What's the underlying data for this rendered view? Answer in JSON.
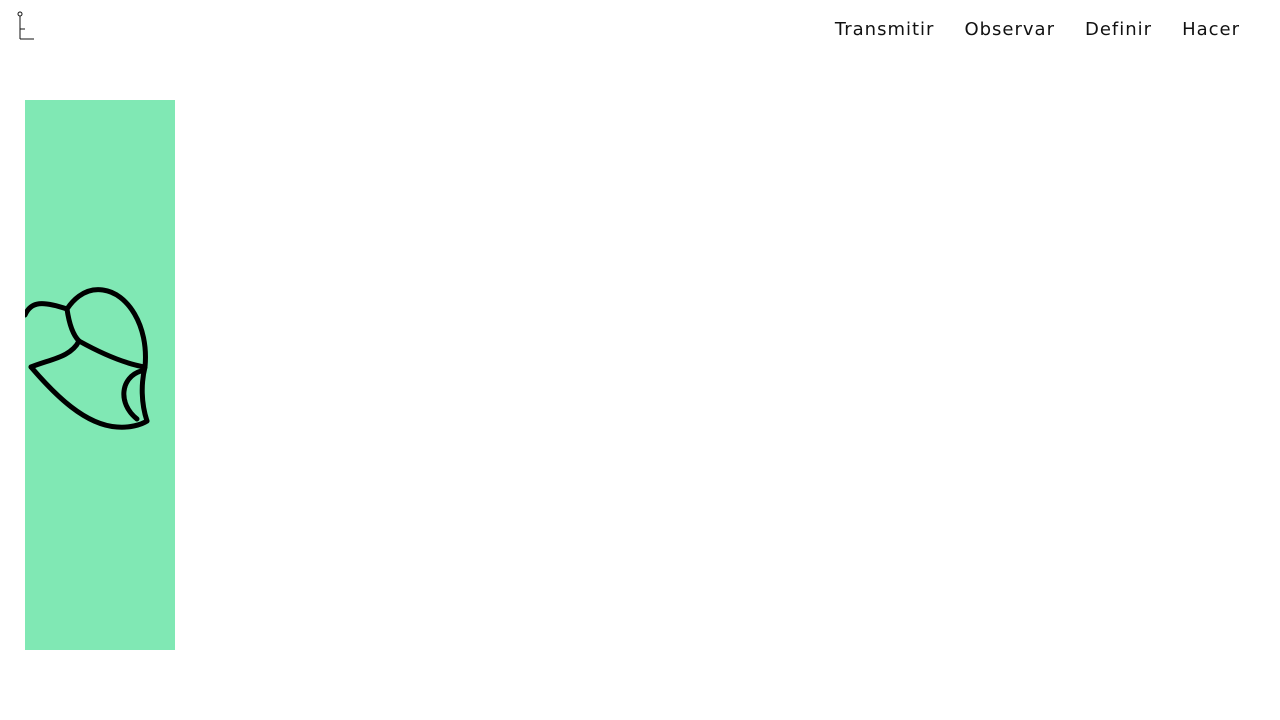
{
  "nav": {
    "items": [
      {
        "label": "Transmitir"
      },
      {
        "label": "Observar"
      },
      {
        "label": "Definir"
      },
      {
        "label": "Hacer"
      }
    ]
  },
  "logo": {
    "icon": "corner-pin-logo-icon"
  },
  "card": {
    "color": "#80e8b4",
    "art_icon": "abstract-leaf-outline-icon"
  }
}
